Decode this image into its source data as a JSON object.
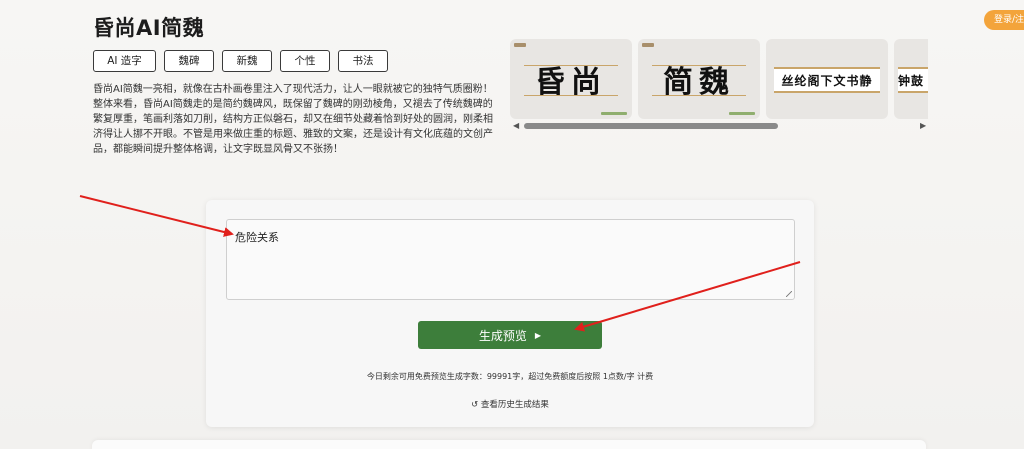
{
  "header": {
    "title": "昏尚AI简魏"
  },
  "tags": [
    "AI 造字",
    "魏碑",
    "新魏",
    "个性",
    "书法"
  ],
  "description": "昏尚AI简魏一亮相，就像在古朴画卷里注入了现代活力，让人一眼就被它的独特气质圈粉！整体来看，昏尚AI简魏走的是简约魏碑风，既保留了魏碑的刚劲棱角，又褪去了传统魏碑的繁复厚重，笔画利落如刀削，结构方正似磐石，却又在细节处藏着恰到好处的圆润，刚柔相济得让人挪不开眼。不管是用来做庄重的标题、雅致的文案，还是设计有文化底蕴的文创产品，都能瞬间提升整体格调，让文字既显风骨又不张扬！",
  "carousel": {
    "slides": [
      {
        "text": "昏尚"
      },
      {
        "text": "简魏"
      },
      {
        "text": "丝纶阁下文书静"
      },
      {
        "text": "钟鼓"
      }
    ],
    "scroll_left": "◀",
    "scroll_right": "▶"
  },
  "login": {
    "label": "登录/注册"
  },
  "editor": {
    "input_value": "危险关系",
    "generate_label": "生成预览",
    "play_glyph": "▶",
    "quota_text": "今日剩余可用免费预览生成字数：99991字，超过免费额度后按照 1点数/字 计费",
    "history_label": "查看历史生成结果",
    "history_icon": "↺"
  },
  "colors": {
    "accent_green": "#3d7e3b",
    "login_orange": "#f3a43b",
    "annotation_red": "#e0201c"
  }
}
